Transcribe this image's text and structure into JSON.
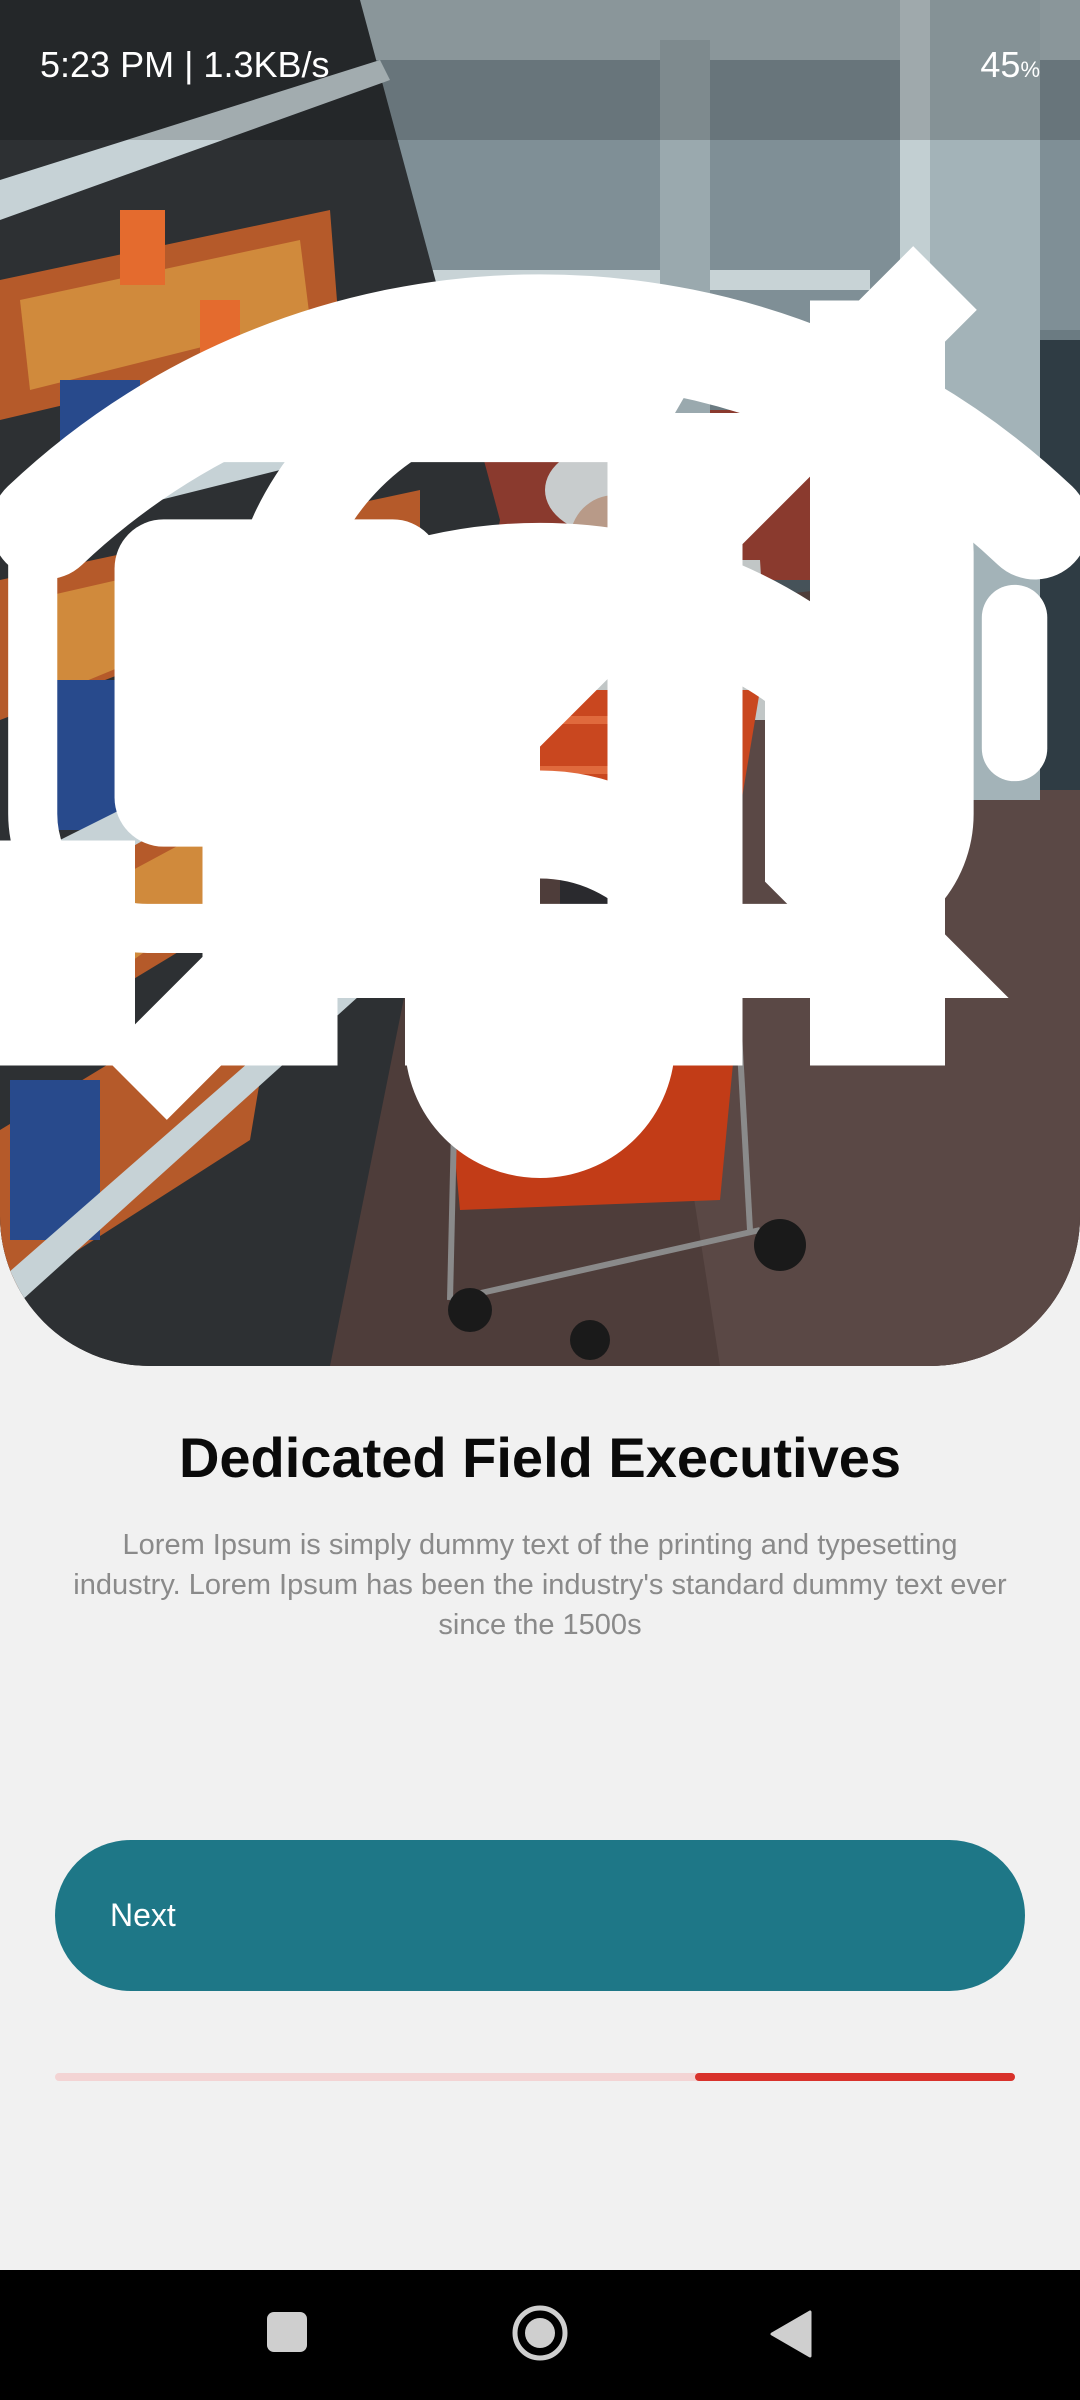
{
  "status_bar": {
    "time_speed": "5:23 PM | 1.3KB/s",
    "battery_percent": "45",
    "battery_unit": "%",
    "icons": [
      "mute-icon",
      "signal-icon",
      "signal-icon",
      "wifi-icon",
      "battery-icon"
    ],
    "battery_level": 0.45
  },
  "hero": {
    "image_description_icon": "supermarket-photo"
  },
  "content": {
    "title": "Dedicated Field Executives",
    "description": "Lorem Ipsum is simply dummy text of the printing and typesetting industry. Lorem Ipsum has been the industry's standard dummy text ever since the 1500s"
  },
  "next_button": {
    "label": "Next",
    "color": "#1e7787"
  },
  "progress": {
    "track_color": "#f3d4d4",
    "fill_color": "#d8322b",
    "fill_start": 0.667,
    "fill_end": 1.0
  },
  "nav_bar": {
    "icons": [
      "recents-icon",
      "home-icon",
      "back-icon"
    ]
  }
}
